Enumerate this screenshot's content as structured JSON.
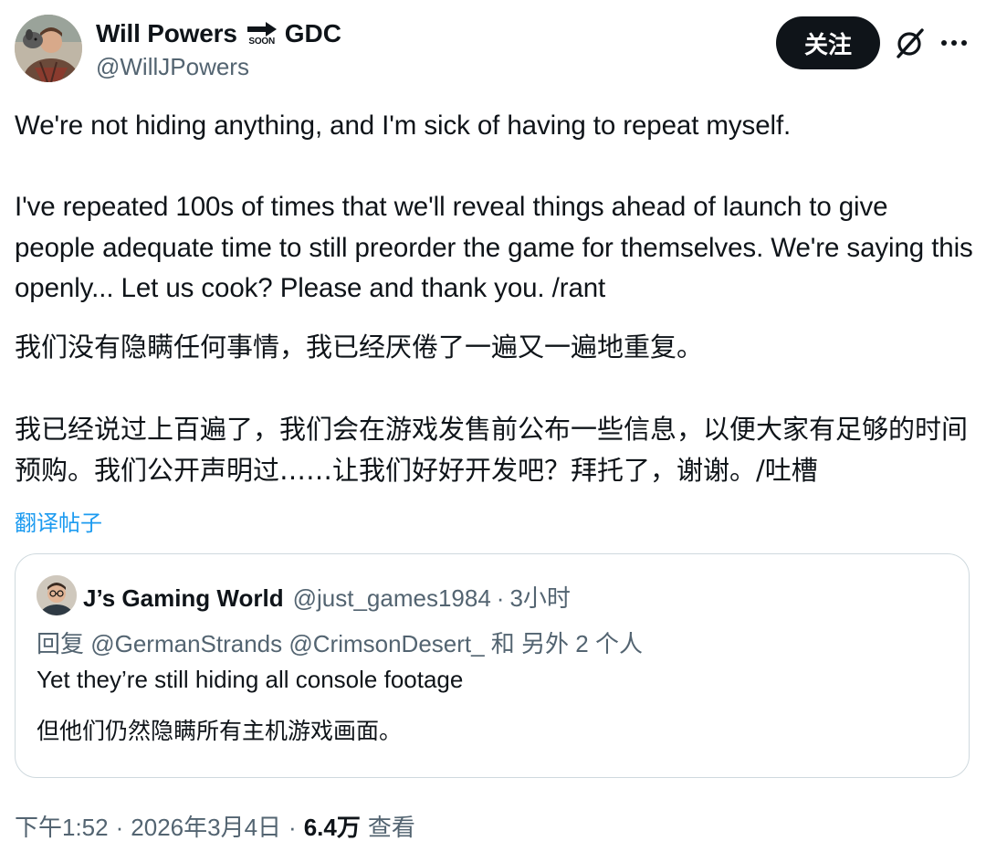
{
  "author": {
    "display_name": "Will Powers",
    "badge_text": "SOON",
    "name_suffix": "GDC",
    "handle": "@WillJPowers",
    "avatar_icon": "person-with-dog-avatar"
  },
  "actions": {
    "follow_label": "关注",
    "grok_icon": "grok-slash-icon",
    "more_icon": "more-horizontal-icon"
  },
  "tweet": {
    "text": "We're not hiding anything, and I'm sick of having to repeat myself.\n\nI've repeated 100s of times that we'll reveal things ahead of launch to give people adequate time to still preorder the game for themselves. We're saying this openly... Let us cook? Please and thank you. /rant",
    "translation": "我们没有隐瞒任何事情，我已经厌倦了一遍又一遍地重复。\n\n我已经说过上百遍了，我们会在游戏发售前公布一些信息，以便大家有足够的时间预购。我们公开声明过……让我们好好开发吧？拜托了，谢谢。/吐槽",
    "translate_link": "翻译帖子"
  },
  "quote": {
    "display_name": "J’s Gaming World",
    "handle": "@just_games1984",
    "dot": "·",
    "time": "3小时",
    "reply_to": "回复 @GermanStrands @CrimsonDesert_ 和 另外 2 个人",
    "text": "Yet they’re still hiding all console footage",
    "translation": "但他们仍然隐瞒所有主机游戏画面。"
  },
  "meta": {
    "time": "下午1:52",
    "date": "2026年3月4日",
    "dot": "·",
    "views_count": "6.4万",
    "views_label": "查看"
  },
  "colors": {
    "text_primary": "#0f1419",
    "text_secondary": "#536471",
    "link": "#1d9bf0",
    "border": "#cfd9de",
    "button_bg": "#0f1419"
  }
}
